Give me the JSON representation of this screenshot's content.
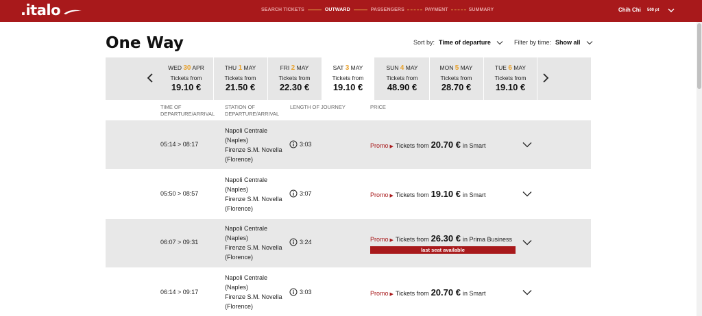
{
  "header": {
    "logo": ".italo",
    "steps": [
      {
        "label": "SEARCH TICKETS",
        "active": false
      },
      {
        "label": "OUTWARD",
        "active": true
      },
      {
        "label": "PASSENGERS",
        "active": false
      },
      {
        "label": "PAYMENT",
        "active": false
      },
      {
        "label": "SUMMARY",
        "active": false
      }
    ],
    "user_name": "Chih Chi",
    "points": "500 pt"
  },
  "page": {
    "title": "One Way",
    "sort_label": "Sort by:",
    "sort_value": "Time of departure",
    "filter_label": "Filter by time:",
    "filter_value": "Show all"
  },
  "dates": [
    {
      "dow": "WED",
      "day": "30",
      "month": "APR",
      "tickets_from": "Tickets from",
      "price": "19.10 €",
      "selected": false
    },
    {
      "dow": "THU",
      "day": "1",
      "month": "MAY",
      "tickets_from": "Tickets from",
      "price": "21.50 €",
      "selected": false
    },
    {
      "dow": "FRI",
      "day": "2",
      "month": "MAY",
      "tickets_from": "Tickets from",
      "price": "22.30 €",
      "selected": false
    },
    {
      "dow": "SAT",
      "day": "3",
      "month": "MAY",
      "tickets_from": "Tickets from",
      "price": "19.10 €",
      "selected": true
    },
    {
      "dow": "SUN",
      "day": "4",
      "month": "MAY",
      "tickets_from": "Tickets from",
      "price": "48.90 €",
      "selected": false
    },
    {
      "dow": "MON",
      "day": "5",
      "month": "MAY",
      "tickets_from": "Tickets from",
      "price": "28.70 €",
      "selected": false
    },
    {
      "dow": "TUE",
      "day": "6",
      "month": "MAY",
      "tickets_from": "Tickets from",
      "price": "19.10 €",
      "selected": false
    }
  ],
  "columns": {
    "time": [
      "TIME OF",
      "DEPARTURE/ARRIVAL"
    ],
    "station": [
      "STATION OF",
      "DEPARTURE/ARRIVAL"
    ],
    "length": "LENGTH OF JOURNEY",
    "price": "PRICE"
  },
  "trains": [
    {
      "time": "05:14 > 08:17",
      "stations": [
        "Napoli Centrale",
        "(Naples)",
        "Firenze S.M. Novella",
        "(Florence)"
      ],
      "duration": "3:03",
      "promo": "Promo",
      "tickets_from": "Tickets from",
      "amount": "20.70 €",
      "class_text": "in Smart",
      "badge": ""
    },
    {
      "time": "05:50 > 08:57",
      "stations": [
        "Napoli Centrale",
        "(Naples)",
        "Firenze S.M. Novella",
        "(Florence)"
      ],
      "duration": "3:07",
      "promo": "Promo",
      "tickets_from": "Tickets from",
      "amount": "19.10 €",
      "class_text": "in Smart",
      "badge": ""
    },
    {
      "time": "06:07 > 09:31",
      "stations": [
        "Napoli Centrale",
        "(Naples)",
        "Firenze S.M. Novella",
        "(Florence)"
      ],
      "duration": "3:24",
      "promo": "Promo",
      "tickets_from": "Tickets from",
      "amount": "26.30 €",
      "class_text": "in Prima Business",
      "badge": "last seat available"
    },
    {
      "time": "06:14 > 09:17",
      "stations": [
        "Napoli Centrale",
        "(Naples)",
        "Firenze S.M. Novella",
        "(Florence)"
      ],
      "duration": "3:03",
      "promo": "Promo",
      "tickets_from": "Tickets from",
      "amount": "20.70 €",
      "class_text": "in Smart",
      "badge": ""
    }
  ],
  "colors": {
    "brand": "#a8191b",
    "accent": "#e8a22e"
  }
}
